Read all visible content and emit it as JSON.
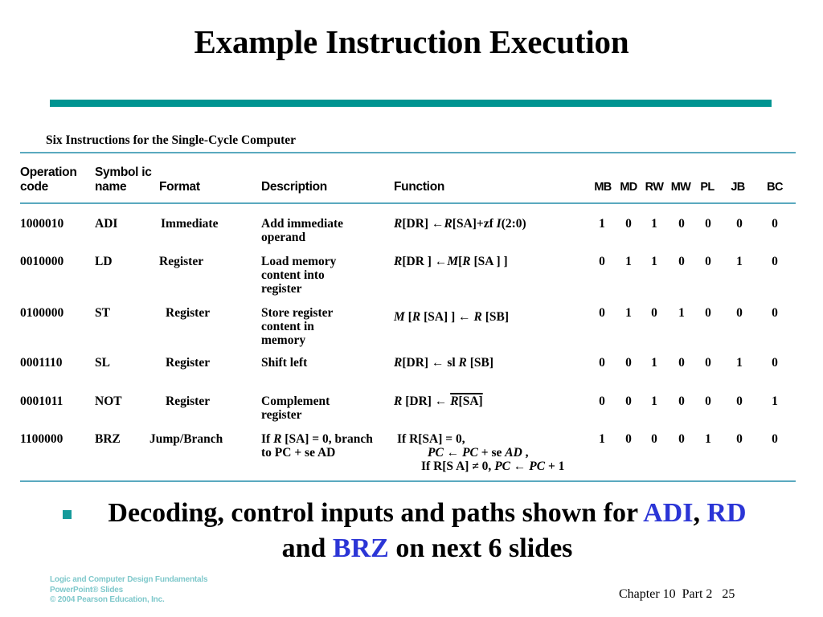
{
  "slide": {
    "title": "Example Instruction Execution",
    "subtitle": "Six Instructions for the Single-Cycle Computer"
  },
  "table": {
    "headers": {
      "operation_code": "Operation\ncode",
      "symbolic_name": "Symbol ic\nname",
      "format": "Format",
      "description": "Description",
      "function": "Function",
      "bits": [
        "MB",
        "MD",
        "RW",
        "MW",
        "PL",
        "JB",
        "BC"
      ]
    },
    "rows": [
      {
        "opcode": "1000010",
        "name": "ADI",
        "format": "Immediate",
        "description": "Add immediate\noperand",
        "function_plain": "R[DR] ← R[SA]+zf I(2:0)",
        "bits": [
          "1",
          "0",
          "1",
          "0",
          "0",
          "0",
          "0"
        ]
      },
      {
        "opcode": "0010000",
        "name": "LD",
        "format": "Register",
        "description": "Load memory\ncontent into\nregister",
        "function_plain": "R[DR] ← M[R [SA]]",
        "bits": [
          "0",
          "1",
          "1",
          "0",
          "0",
          "1",
          "0"
        ]
      },
      {
        "opcode": "0100000",
        "name": "ST",
        "format": "Register",
        "description": "Store register\ncontent in\nmemory",
        "function_plain": "M[R [SA]] ← R[SB]",
        "bits": [
          "0",
          "1",
          "0",
          "1",
          "0",
          "0",
          "0"
        ]
      },
      {
        "opcode": "0001110",
        "name": "SL",
        "format": "Register",
        "description": "Shift left",
        "function_plain": "R[DR] ← sl R [SB]",
        "bits": [
          "0",
          "0",
          "1",
          "0",
          "0",
          "1",
          "0"
        ]
      },
      {
        "opcode": "0001011",
        "name": "NOT",
        "format": "Register",
        "description": "Complement\nregister",
        "function_plain": "R[DR] ← R[SA] (complemented)",
        "bits": [
          "0",
          "0",
          "1",
          "0",
          "0",
          "0",
          "1"
        ]
      },
      {
        "opcode": "1100000",
        "name": "BRZ",
        "format": "Jump/Branch",
        "description": "If R[SA] = 0, branch\nto PC + se AD",
        "function_plain": "If R[SA] = 0, PC ← PC + se AD, If R[SA] ≠ 0, PC ← PC + 1",
        "bits": [
          "1",
          "0",
          "0",
          "0",
          "1",
          "0",
          "0"
        ]
      }
    ]
  },
  "bullet": {
    "part1": "Decoding, control inputs and paths shown for ",
    "hl1": "ADI",
    "sep1": ", ",
    "hl2": "RD",
    "sep2": " and ",
    "hl3": "BRZ",
    "part2": "  on next 6 slides"
  },
  "footer": {
    "credit_line1": "Logic and Computer Design Fundamentals",
    "credit_line2": "PowerPoint® Slides",
    "credit_line3": "© 2004 Pearson Education, Inc.",
    "chapter": "Chapter 10  Part 2   25"
  },
  "colors": {
    "teal_bar": "#009491",
    "rule": "#5aa9bf",
    "bullet_marker": "#169b9b",
    "highlight": "#2b35d6",
    "footer_credit": "#79c6c9"
  }
}
